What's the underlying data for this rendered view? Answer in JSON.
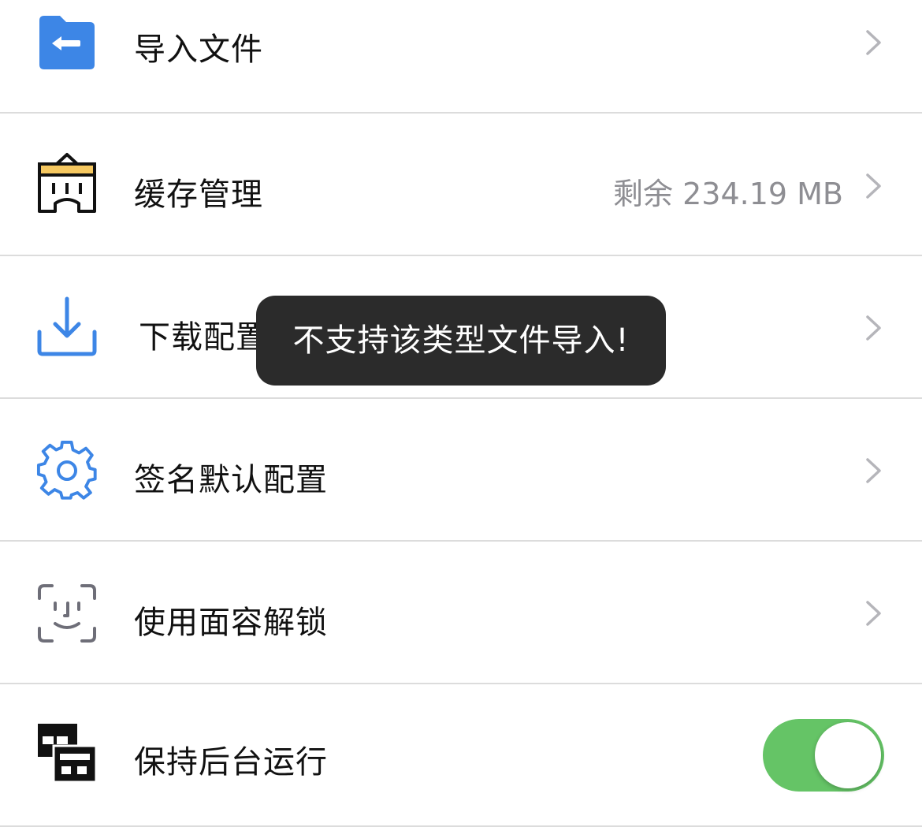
{
  "settings": {
    "items": [
      {
        "label": "导入文件",
        "icon": "folder-import-icon"
      },
      {
        "label": "缓存管理",
        "icon": "cache-building-icon",
        "value": "剩余 234.19 MB"
      },
      {
        "label": "下载配置",
        "icon": "download-icon"
      },
      {
        "label": "签名默认配置",
        "icon": "gear-icon"
      },
      {
        "label": "使用面容解锁",
        "icon": "face-id-icon"
      },
      {
        "label": "保持后台运行",
        "icon": "windows-stack-icon",
        "toggle": true
      }
    ]
  },
  "toast": {
    "message": "不支持该类型文件导入!"
  },
  "colors": {
    "accent": "#3d86e6",
    "toggle_on": "#65c466",
    "cache_highlight": "#f6c860",
    "toast_bg": "#2b2b2b",
    "value_text": "#8e8e93",
    "chevron": "#b5b5ba"
  }
}
